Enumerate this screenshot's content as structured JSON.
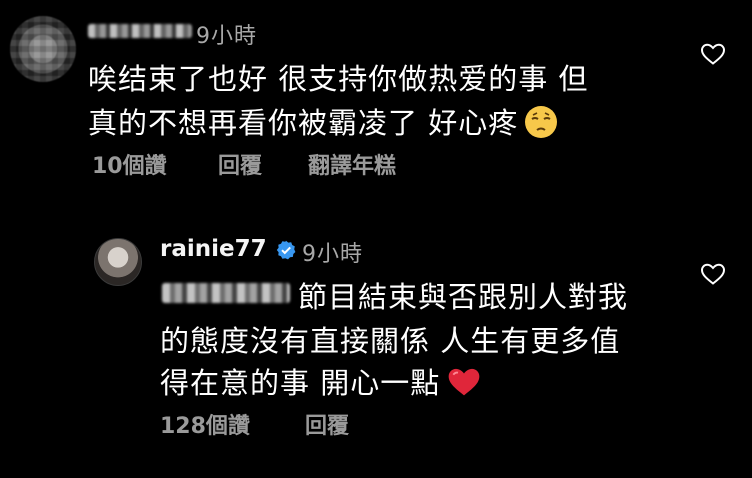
{
  "comment_1": {
    "username": "",
    "time": "9小時",
    "text_line1": "唉结束了也好 很支持你做热爱的事 但",
    "text_line2": "真的不想再看你被霸凌了 好心疼",
    "emoji": "pensive-face",
    "likes": "10個讚",
    "reply": "回覆",
    "translate": "翻譯年糕"
  },
  "reply_1": {
    "username": "rainie77",
    "verified": true,
    "time": "9小時",
    "text_line1": "節目結束與否跟別人對我",
    "text_line2": "的態度沒有直接關係 人生有更多值",
    "text_line3": "得在意的事 開心一點",
    "emoji": "red-heart",
    "likes": "128個讚",
    "reply": "回覆"
  },
  "colors": {
    "background": "#000000",
    "text": "#ffffff",
    "secondary_text": "#a8a8a8",
    "verified_blue": "#3897f0",
    "heart_red": "#e0263a"
  }
}
